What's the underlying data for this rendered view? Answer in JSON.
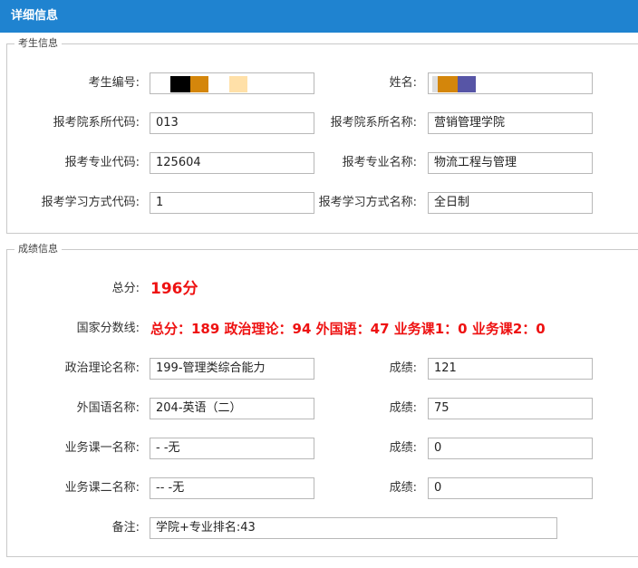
{
  "window": {
    "title": "详细信息"
  },
  "candidate_section": {
    "legend": "考生信息",
    "exam_no_label": "考生编号:",
    "name_label": "姓名:",
    "college_code_label": "报考院系所代码:",
    "college_code": "013",
    "college_name_label": "报考院系所名称:",
    "college_name": "营销管理学院",
    "major_code_label": "报考专业代码:",
    "major_code": "125604",
    "major_name_label": "报考专业名称:",
    "major_name": "物流工程与管理",
    "study_mode_code_label": "报考学习方式代码:",
    "study_mode_code": "1",
    "study_mode_name_label": "报考学习方式名称:",
    "study_mode_name": "全日制",
    "redaction_colors": [
      "#000000",
      "#d4860b",
      "#ffe0a8",
      "#5755a6"
    ]
  },
  "score_section": {
    "legend": "成绩信息",
    "total_label": "总分:",
    "total_value": "196分",
    "national_line_label": "国家分数线:",
    "national_line_value": "总分：189 政治理论：94 外国语：47 业务课1：0 业务课2：0",
    "politics_name_label": "政治理论名称:",
    "politics_name": "199-管理类综合能力",
    "politics_score_label": "成绩:",
    "politics_score": "121",
    "foreign_name_label": "外国语名称:",
    "foreign_name": "204-英语（二）",
    "foreign_score_label": "成绩:",
    "foreign_score": "75",
    "course1_name_label": "业务课一名称:",
    "course1_name": "-  -无",
    "course1_score_label": "成绩:",
    "course1_score": "0",
    "course2_name_label": "业务课二名称:",
    "course2_name": "-- -无",
    "course2_score_label": "成绩:",
    "course2_score": "0",
    "remark_label": "备注:",
    "remark": "学院+专业排名:43"
  },
  "colors": {
    "titlebar": "#1f83d0",
    "highlight_red": "#ee1111"
  }
}
